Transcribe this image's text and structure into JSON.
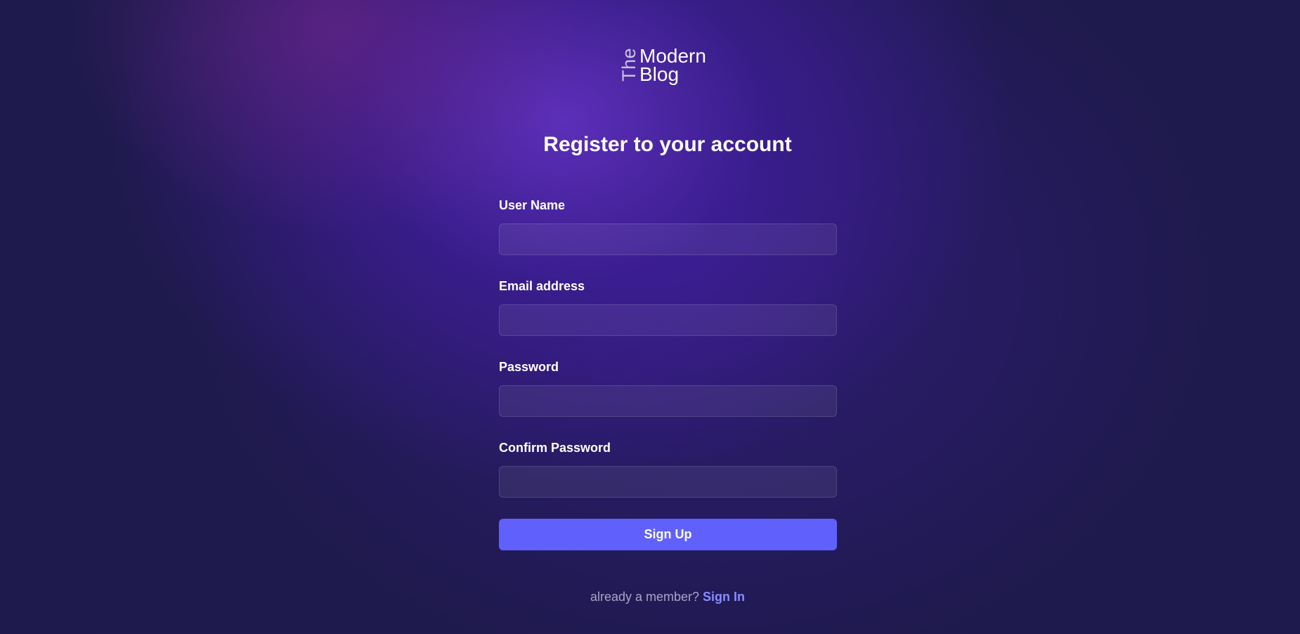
{
  "logo": {
    "the": "The",
    "modern": "Modern",
    "blog": "Blog"
  },
  "title": "Register to your account",
  "form": {
    "fields": [
      {
        "label": "User Name",
        "value": "",
        "placeholder": ""
      },
      {
        "label": "Email address",
        "value": "",
        "placeholder": ""
      },
      {
        "label": "Password",
        "value": "",
        "placeholder": ""
      },
      {
        "label": "Confirm Password",
        "value": "",
        "placeholder": ""
      }
    ],
    "submit_label": "Sign Up"
  },
  "footer": {
    "text": "already a member?",
    "link_label": "Sign In"
  },
  "colors": {
    "accent": "#6061fd",
    "link": "#8a8cff",
    "background": "#1f1a4e"
  }
}
